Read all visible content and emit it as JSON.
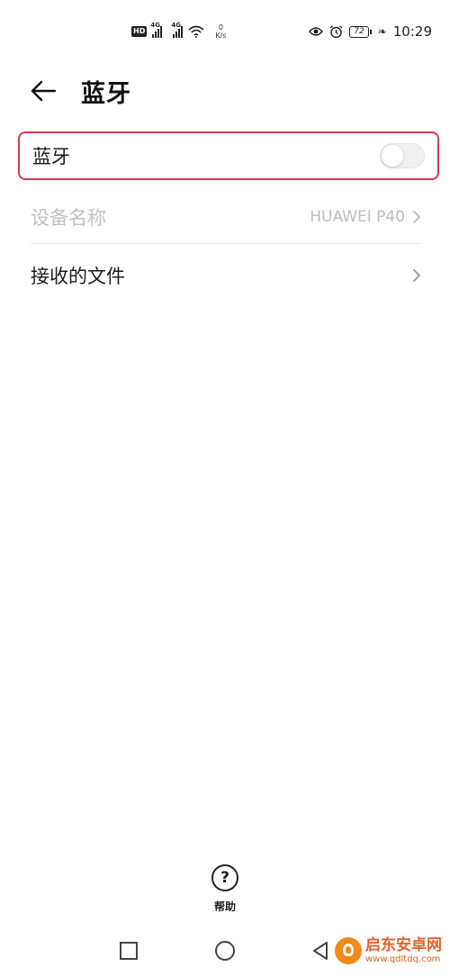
{
  "status_bar": {
    "hd_label": "HD",
    "net_type_1": "4G",
    "net_type_2": "4G",
    "speed_value": "0",
    "speed_unit": "K/s",
    "battery_level": "72",
    "time": "10:29"
  },
  "header": {
    "title": "蓝牙"
  },
  "settings": {
    "bluetooth_label": "蓝牙",
    "bluetooth_enabled": false,
    "device_name_label": "设备名称",
    "device_name_value": "HUAWEI P40",
    "received_files_label": "接收的文件"
  },
  "help": {
    "icon_text": "?",
    "label": "帮助"
  },
  "watermark": {
    "name": "启东安卓网",
    "url": "www.qdltdq.com"
  },
  "colors": {
    "highlight_border": "#d13a4a",
    "watermark": "#e0642a"
  }
}
